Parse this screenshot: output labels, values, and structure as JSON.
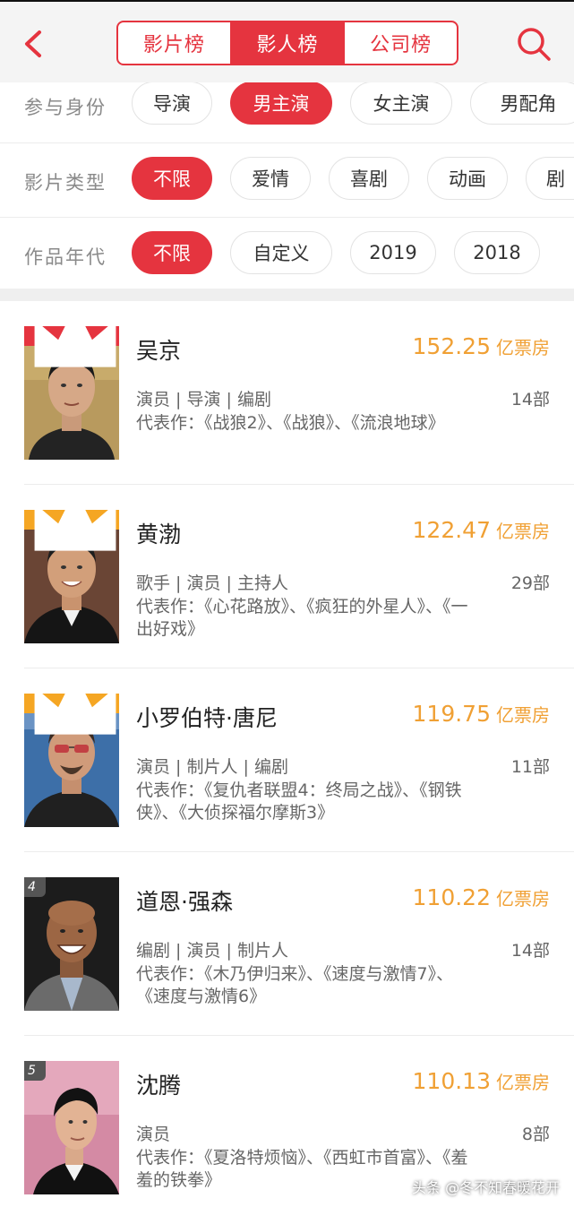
{
  "header": {
    "tabs": [
      {
        "label": "影片榜",
        "active": false
      },
      {
        "label": "影人榜",
        "active": true
      },
      {
        "label": "公司榜",
        "active": false
      }
    ],
    "accent_color": "#e5343f"
  },
  "filters": [
    {
      "label": "参与身份",
      "options": [
        "导演",
        "男主演",
        "女主演",
        "男配角"
      ],
      "selected": "男主演"
    },
    {
      "label": "影片类型",
      "options": [
        "不限",
        "爱情",
        "喜剧",
        "动画",
        "剧"
      ],
      "selected": "不限"
    },
    {
      "label": "作品年代",
      "options": [
        "不限",
        "自定义",
        "2019",
        "2018"
      ],
      "selected": "不限"
    }
  ],
  "ranking": [
    {
      "rank": "1",
      "name": "吴京",
      "box_office": "152.25",
      "unit": "亿票房",
      "roles": "演员 | 导演 | 编剧",
      "count": "14部",
      "works": "代表作：《战狼2》、《战狼》、《流浪地球》"
    },
    {
      "rank": "2",
      "name": "黄渤",
      "box_office": "122.47",
      "unit": "亿票房",
      "roles": "歌手 | 演员 | 主持人",
      "count": "29部",
      "works": "代表作：《心花路放》、《疯狂的外星人》、《一出好戏》"
    },
    {
      "rank": "3",
      "name": "小罗伯特·唐尼",
      "box_office": "119.75",
      "unit": "亿票房",
      "roles": "演员 | 制片人 | 编剧",
      "count": "11部",
      "works": "代表作：《复仇者联盟4：终局之战》、《钢铁侠》、《大侦探福尔摩斯3》"
    },
    {
      "rank": "4",
      "name": "道恩·强森",
      "box_office": "110.22",
      "unit": "亿票房",
      "roles": "编剧 | 演员 | 制片人",
      "count": "14部",
      "works": "代表作：《木乃伊归来》、《速度与激情7》、《速度与激情6》"
    },
    {
      "rank": "5",
      "name": "沈腾",
      "box_office": "110.13",
      "unit": "亿票房",
      "roles": "演员",
      "count": "8部",
      "works": "代表作：《夏洛特烦恼》、《西虹市首富》、《羞羞的铁拳》"
    }
  ],
  "watermark": "头条 @冬不知春暖花开",
  "icons": {
    "back": "chevron-left-icon",
    "search": "search-icon",
    "rank_badge": "crown-icon"
  }
}
